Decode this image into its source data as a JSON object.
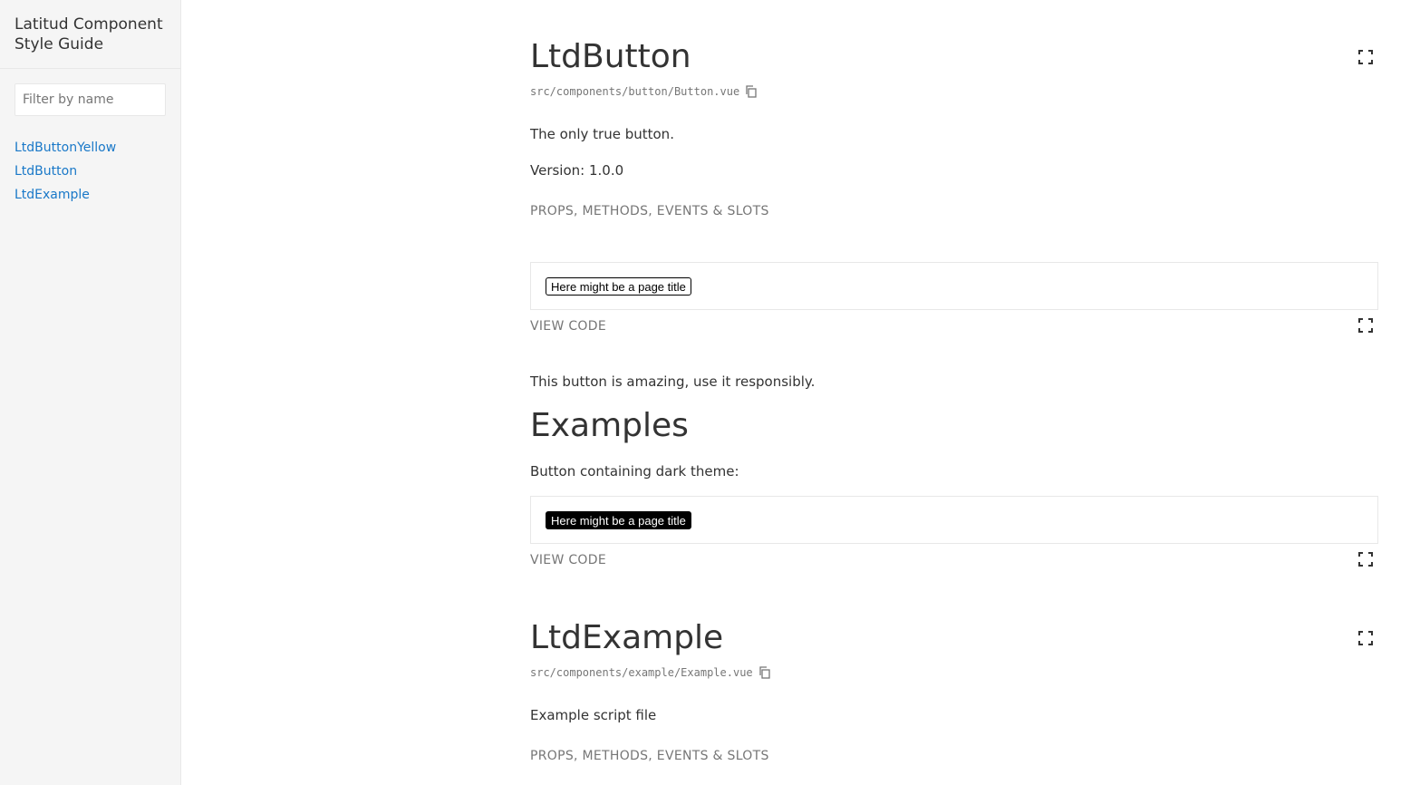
{
  "sidebar": {
    "title": "Latitud Component Style Guide",
    "filter_placeholder": "Filter by name",
    "items": [
      {
        "label": "LtdButtonYellow"
      },
      {
        "label": "LtdButton"
      },
      {
        "label": "LtdExample"
      }
    ]
  },
  "components": {
    "button": {
      "name": "LtdButton",
      "path": "src/components/button/Button.vue",
      "description": "The only true button.",
      "version": "Version: 1.0.0",
      "props_tab": "PROPS, METHODS, EVENTS & SLOTS",
      "demo_label": "Here might be a page title",
      "view_code": "VIEW CODE",
      "note": "This button is amazing, use it responsibly.",
      "examples_heading": "Examples",
      "example_caption": "Button containing dark theme:",
      "example_demo_label": "Here might be a page title",
      "example_view_code": "VIEW CODE"
    },
    "example": {
      "name": "LtdExample",
      "path": "src/components/example/Example.vue",
      "description": "Example script file",
      "props_tab": "PROPS, METHODS, EVENTS & SLOTS"
    }
  },
  "icons": {
    "expand": "expand-icon",
    "copy": "copy-icon"
  },
  "colors": {
    "link": "#1978c8",
    "sidebar_bg": "#f5f5f5",
    "muted_text": "#767676",
    "border": "#e8e8e8"
  }
}
